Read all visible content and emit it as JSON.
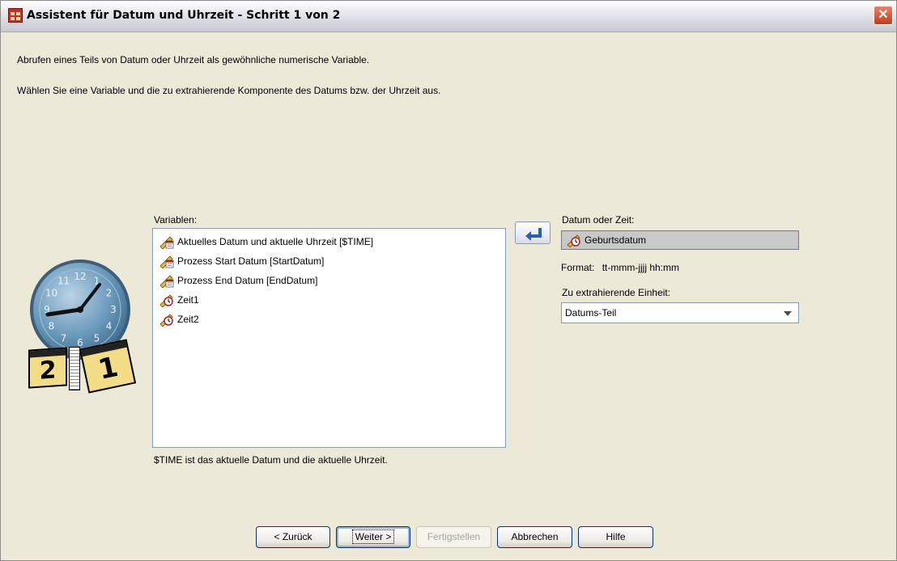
{
  "window": {
    "title": "Assistent für Datum und Uhrzeit - Schritt 1 von 2",
    "close_glyph": "✕"
  },
  "intro": {
    "line1": "Abrufen eines Teils von Datum oder Uhrzeit als gewöhnliche numerische Variable.",
    "line2": "Wählen Sie eine Variable und die zu extrahierende Komponente des Datums bzw. der Uhrzeit aus."
  },
  "variables": {
    "label": "Variablen:",
    "items": [
      {
        "label": "Aktuelles Datum und aktuelle Uhrzeit [$TIME]",
        "icon": "date-ruler-icon"
      },
      {
        "label": "Prozess Start Datum [StartDatum]",
        "icon": "date-ruler-icon"
      },
      {
        "label": "Prozess End Datum [EndDatum]",
        "icon": "date-ruler-icon"
      },
      {
        "label": "Zeit1",
        "icon": "time-ruler-icon"
      },
      {
        "label": "Zeit2",
        "icon": "time-ruler-icon"
      }
    ],
    "note": "$TIME ist das aktuelle Datum und die aktuelle Uhrzeit."
  },
  "target": {
    "label": "Datum oder Zeit:",
    "value": "Geburtsdatum",
    "format_label": "Format:",
    "format_value": "tt-mmm-jjjj hh:mm"
  },
  "unit": {
    "label": "Zu extrahierende Einheit:",
    "selected": "Datums-Teil"
  },
  "illustration": {
    "clock_numbers": [
      "12",
      "1",
      "2",
      "3",
      "4",
      "5",
      "6",
      "7",
      "8",
      "9",
      "10",
      "11"
    ],
    "calendar_left": "2",
    "calendar_right": "1"
  },
  "buttons": {
    "back": "< Zurück",
    "next": "Weiter >",
    "finish": "Fertigstellen",
    "cancel": "Abbrechen",
    "help": "Hilfe"
  },
  "colors": {
    "window_bg": "#ece9d8",
    "list_border": "#7f9db9",
    "close_red": "#c63a1d",
    "clock_blue": "#5f8fb0",
    "arrow_blue": "#2e5fae"
  }
}
